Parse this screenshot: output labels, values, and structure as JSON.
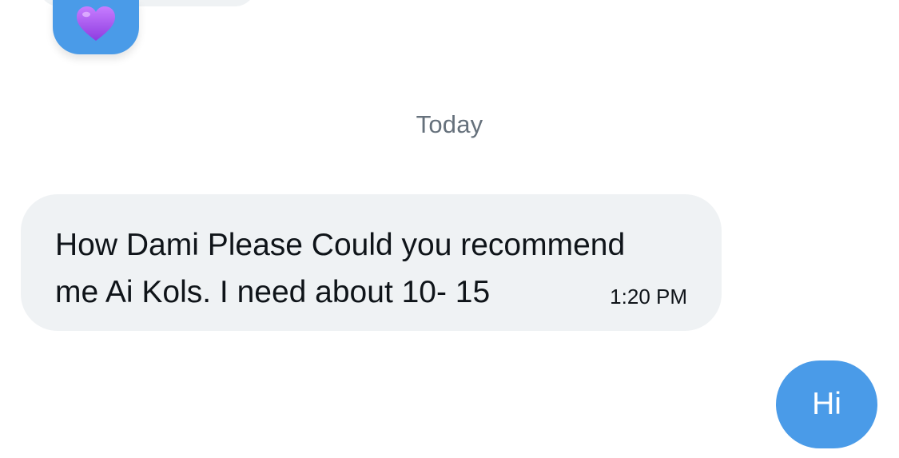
{
  "colors": {
    "outgoing_bubble": "#4a9be8",
    "incoming_bubble": "#eff2f4",
    "date_separator_text": "#66717c",
    "message_text": "#0f1419"
  },
  "previous_message": {
    "reaction": {
      "emoji": "💜",
      "icon": "purple-heart-icon"
    }
  },
  "date_separator": "Today",
  "messages": [
    {
      "direction": "incoming",
      "line1": "How Dami Please Could you recommend",
      "line2": "me Ai Kols. I need about 10- 15",
      "time": "1:20 PM"
    },
    {
      "direction": "outgoing",
      "text": "Hi"
    }
  ]
}
